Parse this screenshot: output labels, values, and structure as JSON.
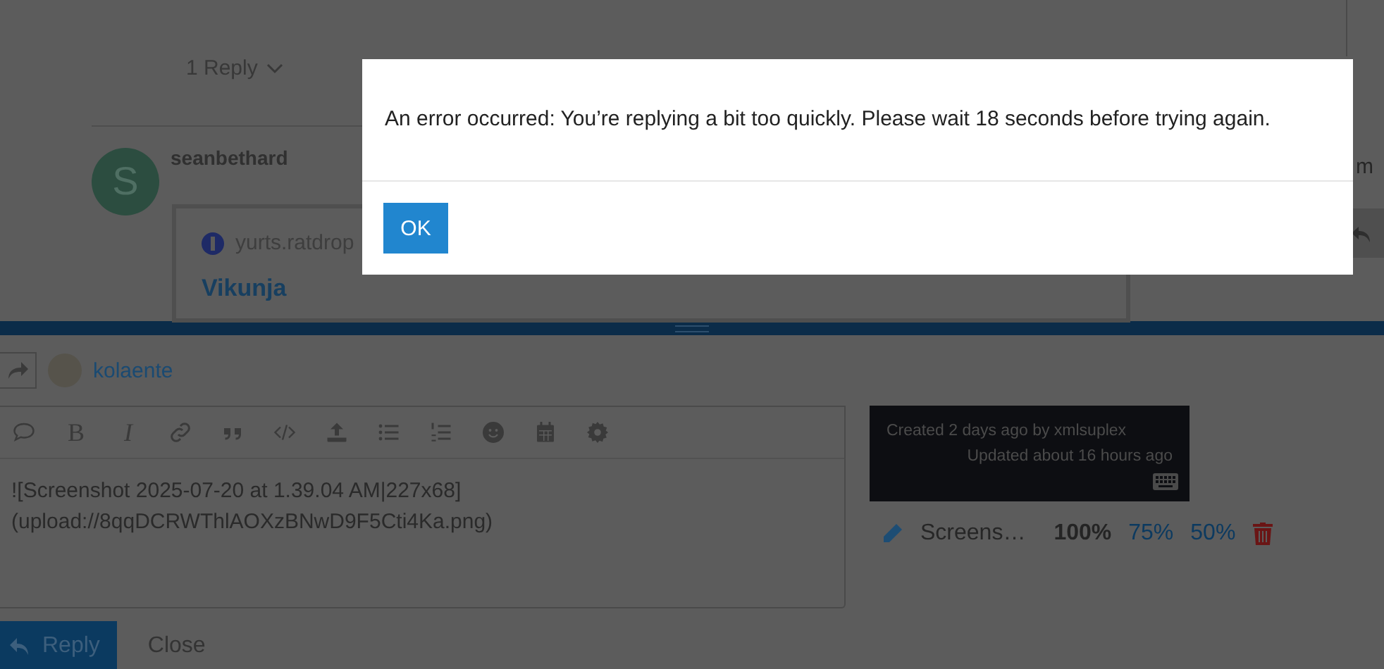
{
  "topic": {
    "replies_toggle": "1 Reply",
    "post": {
      "avatar_letter": "S",
      "username": "seanbethard",
      "onebox": {
        "site": "yurts.ratdrop",
        "title": "Vikunja"
      }
    },
    "side_fragment": "m"
  },
  "composer": {
    "author": "kolaente",
    "toolbar": {
      "bold_label": "B",
      "italic_label": "I"
    },
    "text": "![Screenshot 2025-07-20 at 1.39.04 AM|227x68]\n(upload://8qqDCRWThlAOXzBNwD9F5Cti4Ka.png)",
    "preview": {
      "created": "Created 2 days ago by xmlsuplex",
      "updated": "Updated about 16 hours ago"
    },
    "image_controls": {
      "name": "Screens…",
      "scales": [
        {
          "label": "100%",
          "selected": true
        },
        {
          "label": "75%",
          "selected": false
        },
        {
          "label": "50%",
          "selected": false
        }
      ]
    },
    "buttons": {
      "reply": "Reply",
      "close": "Close"
    }
  },
  "dialog": {
    "message": "An error occurred: You’re replying a bit too quickly. Please wait 18 seconds before trying again.",
    "button": "OK"
  }
}
